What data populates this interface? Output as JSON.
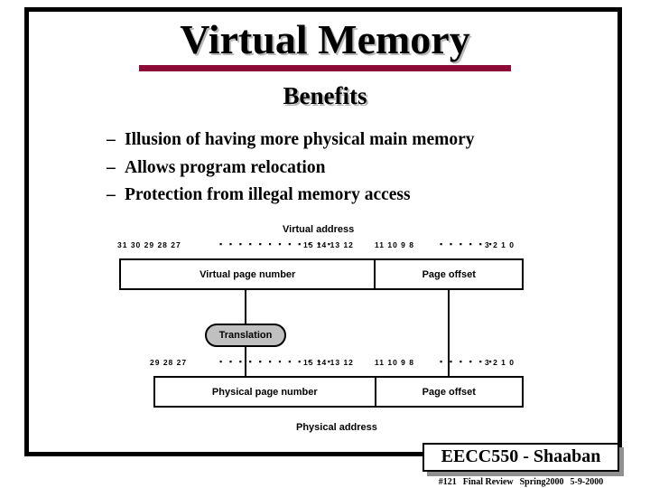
{
  "slide": {
    "title": "Virtual Memory",
    "subtitle": "Benefits",
    "bullets": [
      {
        "marker": "–",
        "text": "Illusion of having more physical main memory"
      },
      {
        "marker": "–",
        "text": "Allows program relocation"
      },
      {
        "marker": "–",
        "text": "Protection from illegal memory access"
      }
    ]
  },
  "diagram": {
    "virtual_address_caption": "Virtual address",
    "physical_address_caption": "Physical address",
    "translation_label": "Translation",
    "virtual_bits": {
      "group1": "31 30 29 28 27",
      "dots1": "▪ ▪ ▪ ▪ ▪ ▪ ▪ ▪ ▪ ▪ ▪ ▪",
      "group2": "15 14 13 12",
      "group3": "11 10 9 8",
      "dots2": "▪ ▪ ▪ ▪ ▪ ▪",
      "group4": "3 2 1 0"
    },
    "physical_bits": {
      "group1": "29 28 27",
      "dots1": "▪ ▪ ▪ ▪ ▪ ▪ ▪ ▪ ▪ ▪ ▪ ▪",
      "group2": "15 14 13 12",
      "group3": "11 10 9 8",
      "dots2": "▪ ▪ ▪ ▪ ▪ ▪",
      "group4": "3 2 1 0"
    },
    "virtual_box": {
      "page_number_label": "Virtual page number",
      "page_offset_label": "Page offset"
    },
    "physical_box": {
      "page_number_label": "Physical page number",
      "page_offset_label": "Page offset"
    }
  },
  "footer": {
    "course": "EECC550 - Shaaban",
    "slide_number": "#121",
    "section": "Final Review",
    "term": "Spring2000",
    "date": "5-9-2000"
  },
  "colors": {
    "title_underline": "#8B0A36",
    "translation_fill": "#c0c0c0",
    "frame_border": "#000000",
    "badge_shadow": "#909090"
  }
}
